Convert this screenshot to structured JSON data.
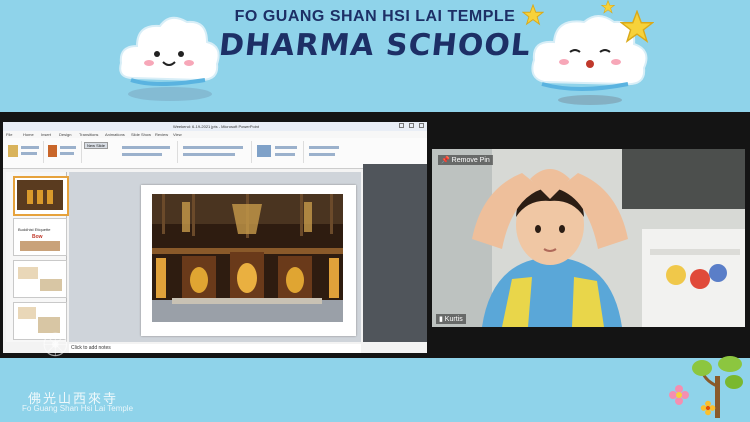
{
  "banner": {
    "title_top": "FO GUANG SHAN HSI LAI TEMPLE",
    "title_main": "DHARMA SCHOOL"
  },
  "powerpoint": {
    "window_title": "Weekend: 6-19-2021 jpts - Microsoft PowerPoint",
    "tabs": [
      "File",
      "Home",
      "Insert",
      "Design",
      "Transitions",
      "Animations",
      "Slide Show",
      "Review",
      "View"
    ],
    "tooltip": "New Slide",
    "thumbnails": [
      {
        "number": "1",
        "title": "",
        "subtitle": ""
      },
      {
        "number": "2",
        "title": "Buddhist Etiquette",
        "subtitle": "Bow"
      },
      {
        "number": "3",
        "title": "",
        "subtitle": ""
      },
      {
        "number": "4",
        "title": "",
        "subtitle": ""
      }
    ],
    "notes_placeholder": "Click to add notes"
  },
  "video": {
    "pin_label": "Remove Pin",
    "participant_name": "Kurtis"
  },
  "footer": {
    "chinese": "佛光山西來寺",
    "english": "Fo Guang Shan Hsi Lai Temple"
  },
  "colors": {
    "background": "#8fd3ea",
    "title": "#1d2f66",
    "stage": "#141414",
    "selected_thumb": "#e6a23c"
  },
  "icons": [
    "cloud-icon",
    "star-icon",
    "tree-icon",
    "flower-icon",
    "dharma-wheel-icon"
  ]
}
